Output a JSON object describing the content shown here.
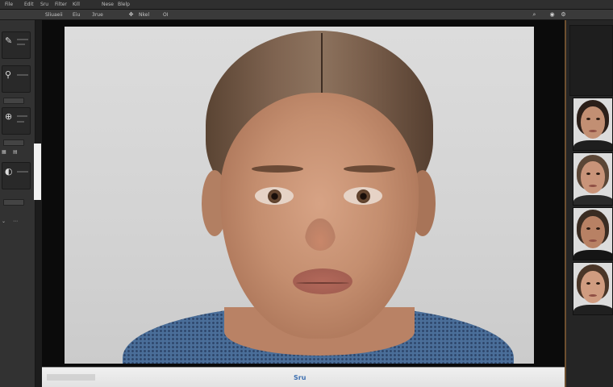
{
  "menubar": {
    "items": [
      "File",
      "Edit",
      "Sru",
      "Filter",
      "Kill",
      "Nese",
      "Blelp"
    ]
  },
  "optionsbar": {
    "items": [
      "Sliuaeii",
      "Eiu",
      "3rue",
      "Nkel",
      "OI"
    ],
    "icons": [
      "move-icon",
      "zoom-icon",
      "lock-icon",
      "settings-icon"
    ]
  },
  "statusbar": {
    "text": "Sru"
  },
  "colors": {
    "ui_dark": "#1c1c1c",
    "panel": "#323232",
    "canvas_bg": "#d6d6d6",
    "accent_border": "#6d4f2f",
    "status_text": "#3d6fb0",
    "sweater": "#4a6e99"
  },
  "right_panel": {
    "thumbnails": [
      "portrait-thumbnail-1",
      "portrait-thumbnail-2",
      "portrait-thumbnail-3",
      "portrait-thumbnail-4"
    ]
  }
}
